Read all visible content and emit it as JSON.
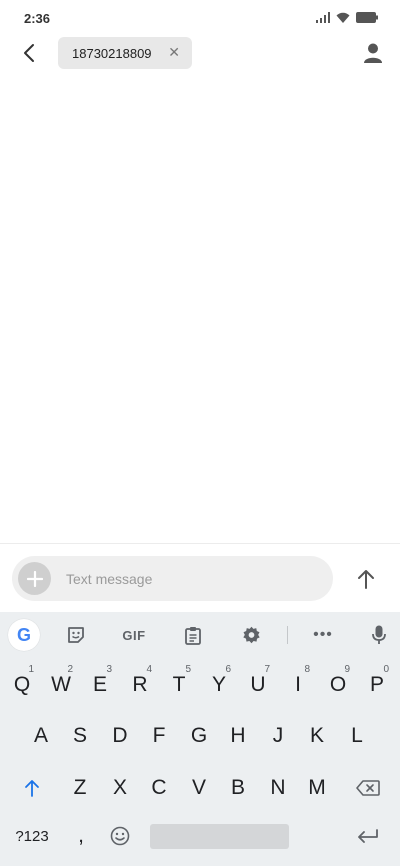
{
  "status_bar": {
    "time": "2:36"
  },
  "header": {
    "recipient": "18730218809",
    "chip_close": "✕"
  },
  "composer": {
    "placeholder": "Text message"
  },
  "keyboard": {
    "toolbar": {
      "gif_label": "GIF",
      "google_letter": "G",
      "more": "•••"
    },
    "row1": [
      {
        "label": "Q",
        "hint": "1"
      },
      {
        "label": "W",
        "hint": "2"
      },
      {
        "label": "E",
        "hint": "3"
      },
      {
        "label": "R",
        "hint": "4"
      },
      {
        "label": "T",
        "hint": "5"
      },
      {
        "label": "Y",
        "hint": "6"
      },
      {
        "label": "U",
        "hint": "7"
      },
      {
        "label": "I",
        "hint": "8"
      },
      {
        "label": "O",
        "hint": "9"
      },
      {
        "label": "P",
        "hint": "0"
      }
    ],
    "row2": [
      "A",
      "S",
      "D",
      "F",
      "G",
      "H",
      "J",
      "K",
      "L"
    ],
    "row3": [
      "Z",
      "X",
      "C",
      "V",
      "B",
      "N",
      "M"
    ],
    "row4": {
      "symbols": "?123",
      "comma": ","
    }
  },
  "colors": {
    "accent_blue": "#1a73e8",
    "keyboard_bg": "#eceff1",
    "chip_bg": "#e8e8e8"
  }
}
